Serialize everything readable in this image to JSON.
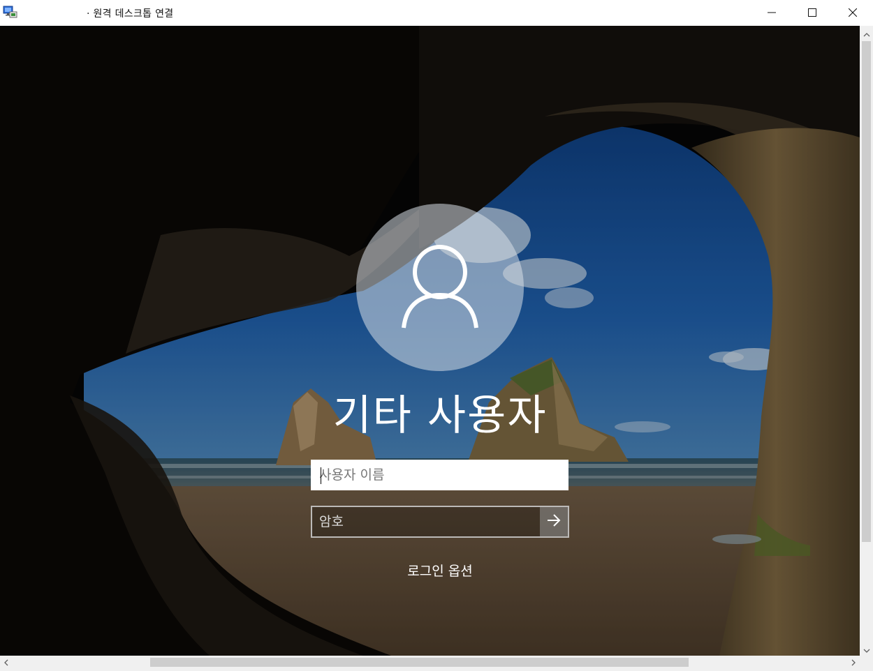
{
  "window": {
    "title": "· 원격 데스크톱 연결",
    "icon": "remote-desktop-icon",
    "controls": {
      "minimize": "minimize-icon",
      "maximize": "maximize-icon",
      "close": "close-icon"
    }
  },
  "login": {
    "user_title": "기타 사용자",
    "username_placeholder": "사용자 이름",
    "username_value": "",
    "password_placeholder": "암호",
    "password_value": "",
    "submit_icon": "arrow-right-icon",
    "sign_in_options": "로그인 옵션"
  },
  "colors": {
    "titlebar_bg": "#ffffff",
    "scrollbar_track": "#f0f0f0",
    "scrollbar_thumb": "#cdcdcd",
    "text_light": "#ffffff"
  }
}
